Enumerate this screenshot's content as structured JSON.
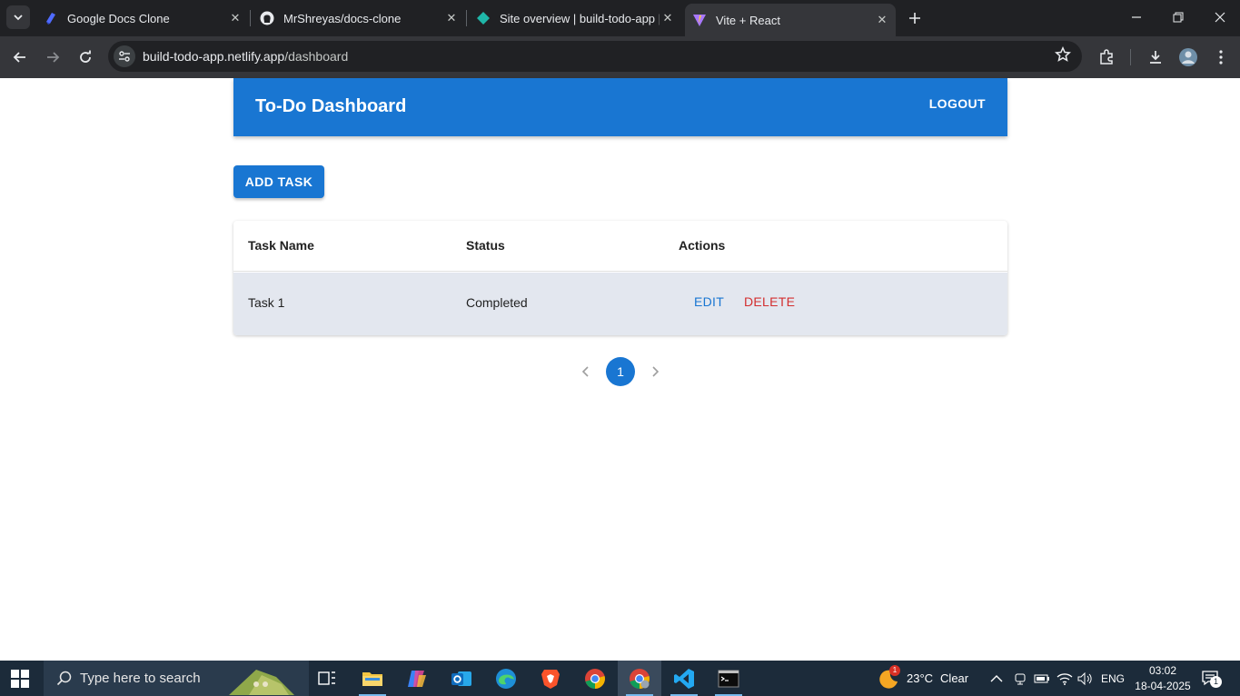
{
  "browser": {
    "tabs": [
      {
        "title": "Google Docs Clone"
      },
      {
        "title": "MrShreyas/docs-clone"
      },
      {
        "title": "Site overview | build-todo-app |"
      },
      {
        "title": "Vite + React"
      }
    ],
    "url_host": "build-todo-app.netlify.app",
    "url_path": "/dashboard"
  },
  "app": {
    "title": "To-Do Dashboard",
    "logout_label": "LOGOUT",
    "add_task_label": "ADD TASK",
    "table": {
      "headers": [
        "Task Name",
        "Status",
        "Actions"
      ],
      "rows": [
        {
          "name": "Task 1",
          "status": "Completed",
          "edit_label": "EDIT",
          "delete_label": "DELETE"
        }
      ]
    },
    "pagination": {
      "current_page": "1"
    }
  },
  "taskbar": {
    "search_placeholder": "Type here to search",
    "weather": {
      "temp": "23°C",
      "condition": "Clear",
      "badge": "1"
    },
    "language": "ENG",
    "time": "03:02",
    "date": "18-04-2025",
    "notification_count": "1"
  },
  "colors": {
    "primary": "#1976d2",
    "danger": "#d32f2f",
    "row_highlight": "#e3e7ef"
  }
}
